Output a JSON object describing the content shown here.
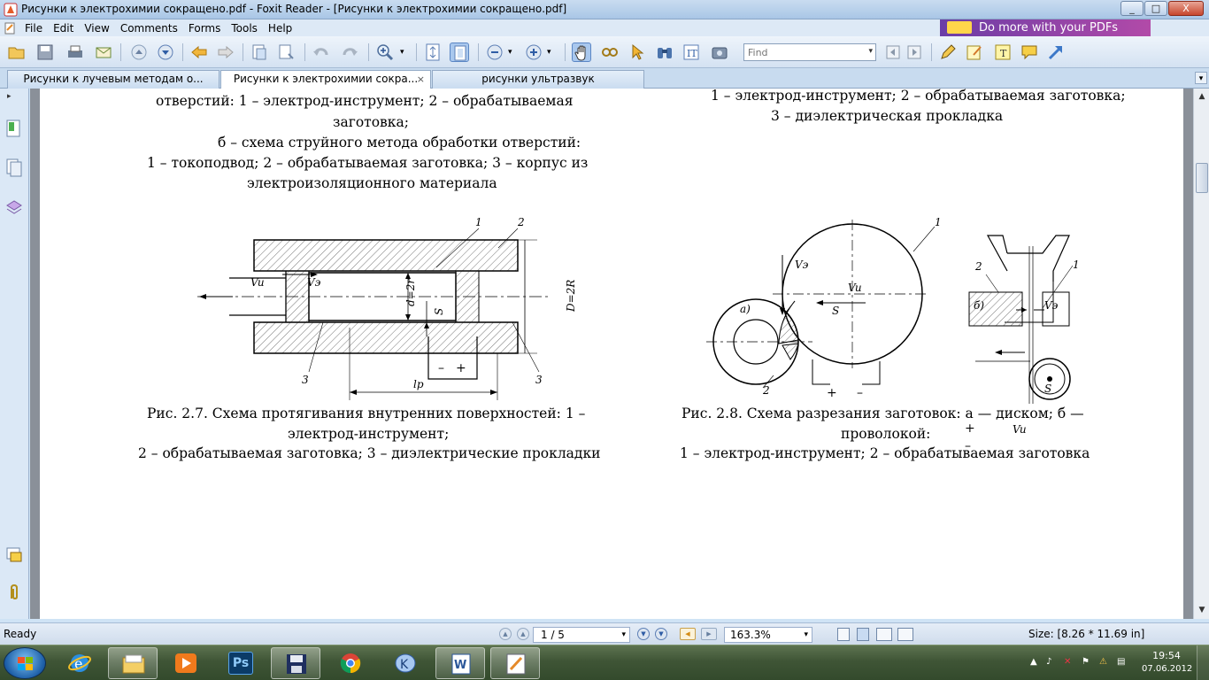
{
  "window": {
    "title": "Рисунки к электрохимии сокращено.pdf - Foxit Reader - [Рисунки к электрохимии сокращено.pdf]",
    "minimize": "_",
    "maximize": "□",
    "close": "X"
  },
  "menu": {
    "items": [
      "File",
      "Edit",
      "View",
      "Comments",
      "Forms",
      "Tools",
      "Help"
    ],
    "promo": "Do more with your PDFs"
  },
  "toolbar": {
    "find_placeholder": "Find"
  },
  "tabs": [
    {
      "label": "Рисунки к лучевым методам о..."
    },
    {
      "label": "Рисунки к электрохимии сокра...",
      "close": "×"
    },
    {
      "label": "рисунки ультразвук"
    }
  ],
  "document": {
    "left_top": {
      "line1": "отверстий:  1 – электрод-инструмент; 2 – обрабатываемая",
      "line2": "заготовка;",
      "line3": "б – схема струйного метода обработки отверстий:",
      "line4": "1 – токоподвод; 2 – обрабатываемая заготовка; 3 – корпус из",
      "line5": "электроизоляционного материала"
    },
    "right_top": {
      "line1": "1 – электрод-инструмент; 2 – обрабатываемая заготовка;",
      "line2": "3 – диэлектрическая прокладка"
    },
    "fig27": {
      "label_1": "1",
      "label_2": "2",
      "label_3a": "3",
      "label_3b": "3",
      "vu": "Vu",
      "ve": "Vэ",
      "d": "d=2r",
      "D": "D=2R",
      "s": "S",
      "minus": "–",
      "plus": "+",
      "lp": "lр"
    },
    "fig28": {
      "label_a": "а)",
      "label_b": "б)",
      "label_1a": "1",
      "label_2a": "2",
      "label_1b": "1",
      "label_2b": "2",
      "ve_a": "Vэ",
      "vu_a": "Vu",
      "s_a": "S",
      "plus_a": "+",
      "minus_a": "–",
      "ve_b": "Vэ",
      "s_b": "S",
      "plus_b": "+",
      "minus_b": "–",
      "vu_b": "Vu"
    },
    "caption_27": {
      "line1": "Рис. 2.7. Схема протягивания внутренних поверхностей: 1 –",
      "line2": "электрод-инструмент;",
      "line3": "2 – обрабатываемая заготовка; 3 – диэлектрические прокладки"
    },
    "caption_28": {
      "line1": "Рис. 2.8. Схема разрезания заготовок: а — диском; б —",
      "line2": "проволокой:",
      "line3": "1 – электрод-инструмент; 2 – обрабатываемая заготовка"
    }
  },
  "statusbar": {
    "status": "Ready",
    "page": "1 / 5",
    "zoom": "163.3%",
    "size": "Size: [8.26 * 11.69 in]"
  },
  "taskbar": {
    "ps_label": "Ps",
    "time": "19:54",
    "date": "07.06.2012"
  },
  "colors": {
    "promo_start": "#6b3da6",
    "promo_end": "#b24aa8",
    "taskbar": "#3f5536"
  }
}
